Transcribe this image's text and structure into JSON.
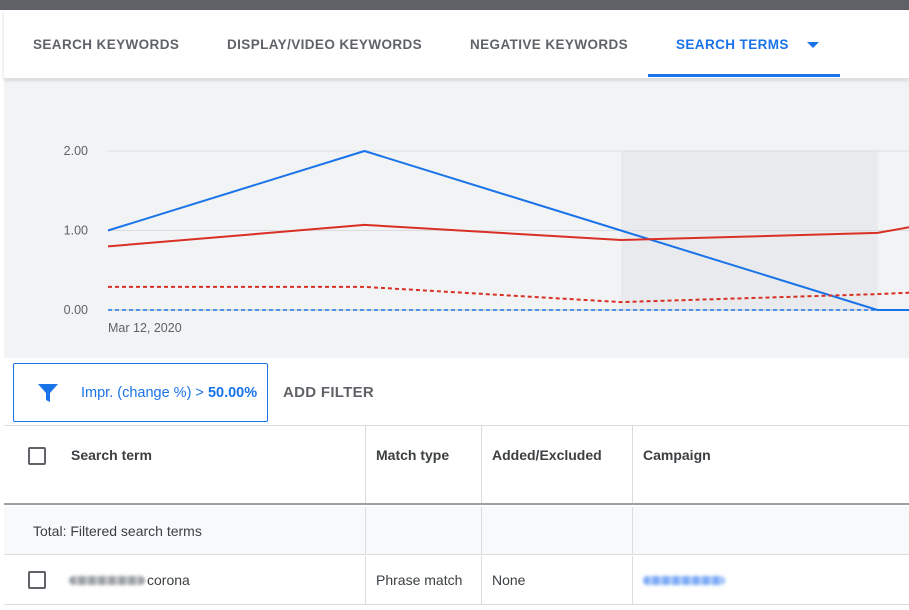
{
  "tabs": [
    {
      "label": "SEARCH KEYWORDS",
      "active": false
    },
    {
      "label": "DISPLAY/VIDEO KEYWORDS",
      "active": false
    },
    {
      "label": "NEGATIVE KEYWORDS",
      "active": false
    },
    {
      "label": "SEARCH TERMS",
      "active": true
    }
  ],
  "chart_data": {
    "type": "line",
    "y_ticks": [
      "2.00",
      "1.00",
      "0.00"
    ],
    "ylim": [
      0,
      2
    ],
    "x_start_label": "Mar 12, 2020",
    "x": [
      0,
      1,
      2,
      3,
      3.14
    ],
    "series": [
      {
        "values": [
          1.0,
          2.0,
          1.0,
          0.0,
          0.0
        ],
        "color": "#1a73e8",
        "style": "solid"
      },
      {
        "values": [
          0.8,
          1.07,
          0.88,
          0.97,
          1.05
        ],
        "color": "#d93025",
        "style": "solid"
      },
      {
        "values": [
          0.29,
          0.29,
          0.1,
          0.2,
          0.22
        ],
        "color": "#d93025",
        "style": "dashed"
      },
      {
        "values": [
          0.0,
          0.0,
          0.0,
          0.0,
          0.0
        ],
        "color": "#1a73e8",
        "style": "dashed"
      }
    ],
    "highlight_x_range": [
      2,
      3
    ],
    "grid": true
  },
  "filter": {
    "label": "Impr. (change %) >",
    "value": "50.00%",
    "icon": "filter-funnel-icon"
  },
  "add_filter_label": "ADD FILTER",
  "table": {
    "columns": [
      "Search term",
      "Match type",
      "Added/Excluded",
      "Campaign"
    ],
    "total_label": "Total: Filtered search terms",
    "rows": [
      {
        "term_suffix": "corona",
        "match_type": "Phrase match",
        "added_excluded": "None"
      }
    ]
  },
  "colors": {
    "accent": "#1a73e8",
    "series_red": "#d93025",
    "chart_bg": "#f1f3f4"
  }
}
